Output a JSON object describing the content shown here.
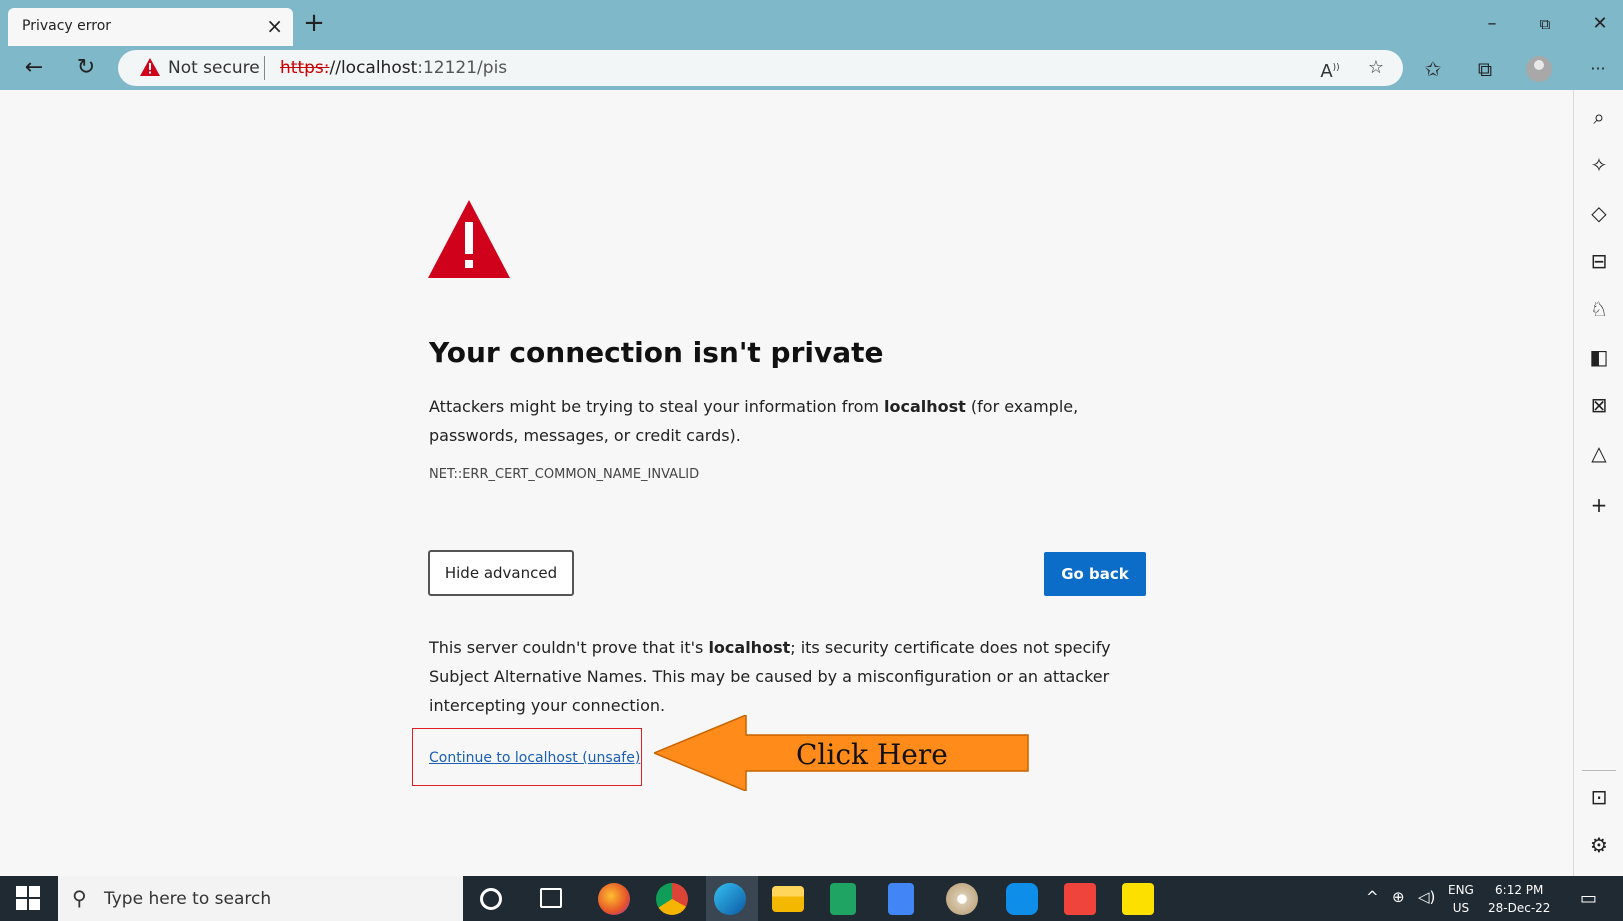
{
  "browser": {
    "tab_title": "Privacy error",
    "tab_close": "×",
    "new_tab": "+",
    "window_controls": {
      "minimize": "–",
      "restore": "⧉",
      "close": "✕"
    },
    "nav": {
      "back": "←",
      "refresh": "↻",
      "more": "···"
    },
    "address": {
      "security_label": "Not secure",
      "url_scheme": "https:",
      "url_host": "//localhost",
      "url_rest": ":12121/pis"
    },
    "icons": [
      "read-aloud-icon",
      "add-favorite-icon",
      "favorites-icon",
      "collections-icon",
      "profile-icon"
    ]
  },
  "sidebar": {
    "icons": [
      "search-icon",
      "copilot-icon",
      "shopping-tag-icon",
      "tools-icon",
      "games-icon",
      "office-icon",
      "outlook-icon",
      "drop-icon",
      "add-icon",
      "split-screen-icon",
      "settings-icon"
    ]
  },
  "page": {
    "heading": "Your connection isn't private",
    "desc_pre": "Attackers might be trying to steal your information from ",
    "desc_host": "localhost",
    "desc_post": " (for example, passwords, messages, or credit cards).",
    "error_code": "NET::ERR_CERT_COMMON_NAME_INVALID",
    "hide_advanced": "Hide advanced",
    "go_back": "Go back",
    "detail_pre": "This server couldn't prove that it's ",
    "detail_host": "localhost",
    "detail_post": "; its security certificate does not specify Subject Alternative Names. This may be caused by a misconfiguration or an attacker intercepting your connection.",
    "continue_link": "Continue to localhost (unsafe)",
    "annotation": "Click Here"
  },
  "colors": {
    "accent_blue": "#0b6dc8",
    "warning_red": "#d0021b",
    "arrow_orange": "#ff8c1a"
  },
  "taskbar": {
    "search_placeholder": "Type here to search",
    "apps": [
      "cortana-icon",
      "task-view-icon",
      "firefox-icon",
      "chrome-icon",
      "edge-icon",
      "file-explorer-icon",
      "sheets-icon",
      "docs-icon",
      "paint-icon",
      "teamviewer-icon",
      "anydesk-icon",
      "sticky-notes-icon"
    ],
    "lang_line1": "ENG",
    "lang_line2": "US",
    "time": "6:12 PM",
    "date": "28-Dec-22"
  }
}
